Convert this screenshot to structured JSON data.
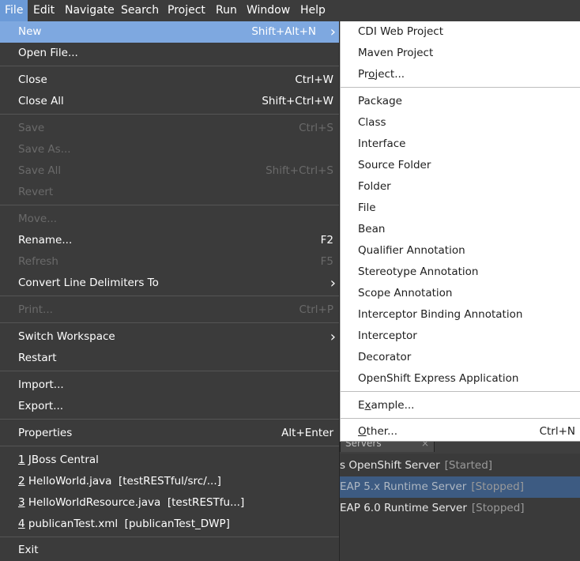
{
  "menubar": {
    "items": [
      "File",
      "Edit",
      "Navigate",
      "Search",
      "Project",
      "Run",
      "Window",
      "Help"
    ]
  },
  "file_menu": {
    "new": {
      "label": "New",
      "shortcut": "Shift+Alt+N"
    },
    "open_file": {
      "label": "Open File..."
    },
    "close": {
      "label": "Close",
      "shortcut": "Ctrl+W"
    },
    "close_all": {
      "label": "Close All",
      "shortcut": "Shift+Ctrl+W"
    },
    "save": {
      "label": "Save",
      "shortcut": "Ctrl+S"
    },
    "save_as": {
      "label": "Save As..."
    },
    "save_all": {
      "label": "Save All",
      "shortcut": "Shift+Ctrl+S"
    },
    "revert": {
      "label": "Revert"
    },
    "move": {
      "label": "Move..."
    },
    "rename": {
      "label": "Rename...",
      "shortcut": "F2"
    },
    "refresh": {
      "label": "Refresh",
      "shortcut": "F5"
    },
    "convert_line_delimiters": {
      "label": "Convert Line Delimiters To"
    },
    "print": {
      "label": "Print...",
      "shortcut": "Ctrl+P"
    },
    "switch_workspace": {
      "label": "Switch Workspace"
    },
    "restart": {
      "label": "Restart"
    },
    "import": {
      "label": "Import..."
    },
    "export": {
      "label": "Export..."
    },
    "properties": {
      "label": "Properties",
      "shortcut": "Alt+Enter"
    },
    "recent_files": [
      {
        "num": "1",
        "label": "JBoss Central"
      },
      {
        "num": "2",
        "label": "HelloWorld.java  [testRESTful/src/...]"
      },
      {
        "num": "3",
        "label": "HelloWorldResource.java  [testRESTfu...]"
      },
      {
        "num": "4",
        "label": "publicanTest.xml  [publicanTest_DWP]"
      }
    ],
    "exit": {
      "label": "Exit"
    }
  },
  "new_submenu": {
    "cdi_web_project": "CDI Web Project",
    "maven_project": "Maven Project",
    "project": {
      "before": "Pr",
      "mnemonic": "o",
      "after": "ject..."
    },
    "package": "Package",
    "class": "Class",
    "interface": "Interface",
    "source_folder": "Source Folder",
    "folder": "Folder",
    "file": "File",
    "bean": "Bean",
    "qualifier_annotation": "Qualifier Annotation",
    "stereotype_annotation": "Stereotype Annotation",
    "scope_annotation": "Scope Annotation",
    "interceptor_binding_annotation": "Interceptor Binding Annotation",
    "interceptor": "Interceptor",
    "decorator": "Decorator",
    "openshift_express_application": "OpenShift Express Application",
    "example": {
      "before": "E",
      "mnemonic": "x",
      "after": "ample..."
    },
    "other": {
      "before": "",
      "mnemonic": "O",
      "after": "ther...",
      "shortcut": "Ctrl+N"
    }
  },
  "servers_view": {
    "tab_label": "Servers",
    "rows": [
      {
        "name": "s OpenShift Server",
        "status": "[Started]"
      },
      {
        "name": "EAP 5.x Runtime Server",
        "status": "[Stopped]"
      },
      {
        "name": "EAP 6.0 Runtime Server",
        "status": "[Stopped]"
      }
    ]
  },
  "colors": {
    "menubar_active": "#6b9ad7",
    "menu_highlight": "#7ea8e0",
    "menu_background": "#3b3b3b",
    "submenu_background": "#ffffff",
    "selected_server_row": "#3d5b82"
  }
}
